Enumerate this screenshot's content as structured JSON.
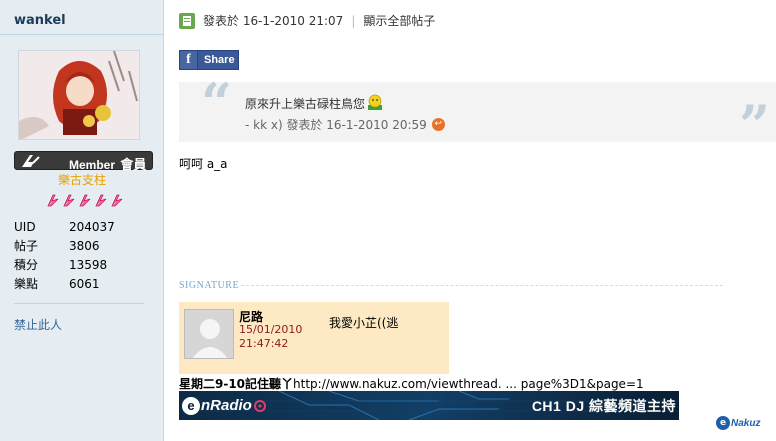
{
  "author": {
    "username": "wankel",
    "rank_label": "Member",
    "rank_label_zh": "會員",
    "group_title": "樂古支柱",
    "star_count": 5,
    "stats": [
      {
        "key": "UID",
        "value": "204037"
      },
      {
        "key": "帖子",
        "value": "3806"
      },
      {
        "key": "積分",
        "value": "13598"
      },
      {
        "key": "樂點",
        "value": "6061"
      }
    ],
    "ban_link": "禁止此人"
  },
  "post": {
    "posted_at": "發表於 16-1-2010 21:07",
    "show_all": "顯示全部帖子",
    "share_label": "Share",
    "quote": {
      "text": "原來升上樂古碌柱鳥您",
      "attribution": "-    kk    x) 發表於 16-1-2010 20:59"
    },
    "body": "呵呵 a_a"
  },
  "signature": {
    "label": "SIGNATURE",
    "card": {
      "name": "尼路",
      "date": "15/01/2010",
      "time": "21:47:42",
      "message": "我愛小芷((逃"
    },
    "link_prefix": "星期二9-10記住聽丫",
    "link_text": "http://www.nakuz.com/viewthread. ... page%3D1&page=1",
    "banner_logo": "nRadio",
    "banner_text": "CH1 DJ  綜藝頻道主持",
    "watermark": "Nakuz"
  },
  "colors": {
    "sidebar_bg": "#e5edf2",
    "group_title": "#e6a100",
    "link": "#336699",
    "facebook": "#3b5998",
    "sig_card_bg": "#fdeac4"
  }
}
